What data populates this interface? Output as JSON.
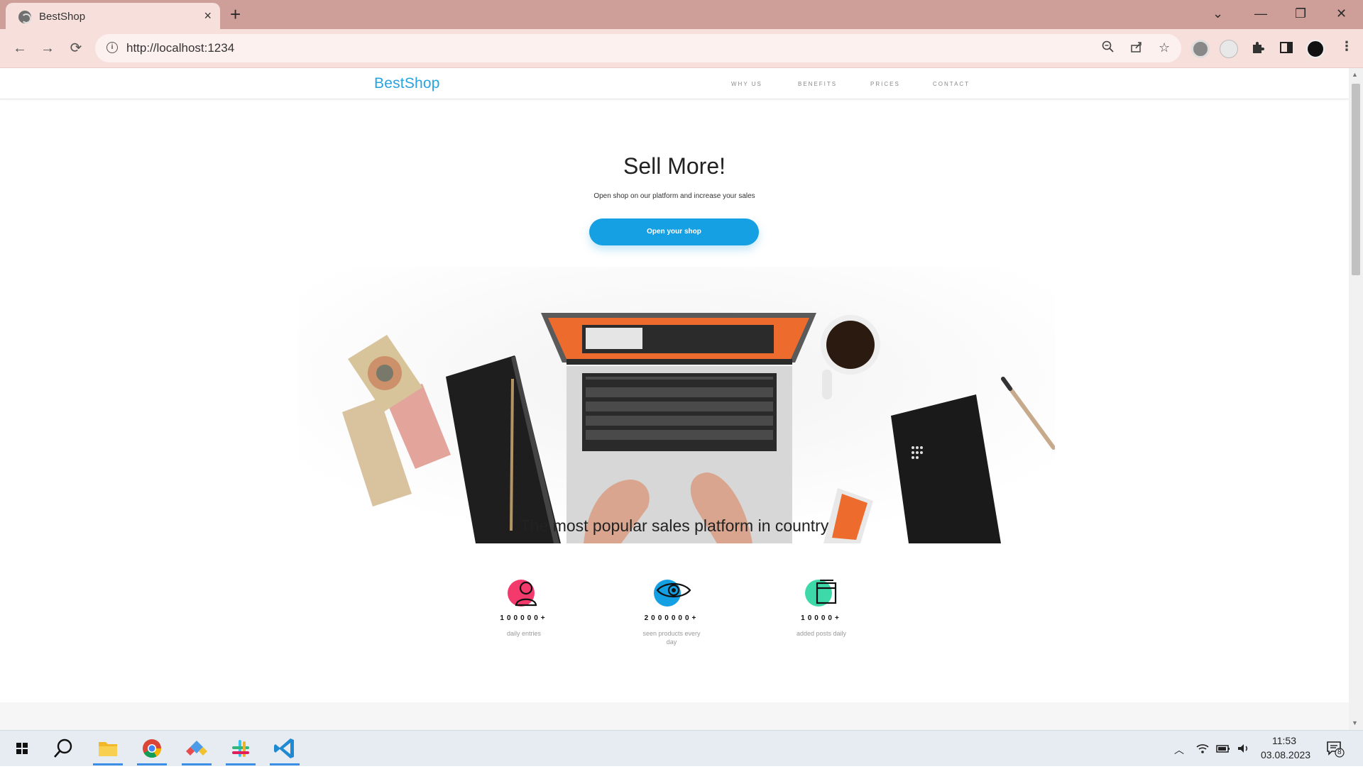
{
  "browser": {
    "tab_title": "BestShop",
    "tab_close": "×",
    "new_tab": "+",
    "url": "http://localhost:1234",
    "window_controls": {
      "dropdown": "⌄",
      "minimize": "—",
      "restore": "❐",
      "close": "✕"
    }
  },
  "site": {
    "logo": "BestShop",
    "nav": [
      "WHY US",
      "BENEFITS",
      "PRICES",
      "CONTACT"
    ]
  },
  "hero": {
    "title": "Sell More!",
    "subtitle": "Open shop on our platform and increase your sales",
    "cta_label": "Open your shop"
  },
  "stats": {
    "title": "The most popular sales platform in country",
    "items": [
      {
        "value": "100000+",
        "label": "daily entries",
        "icon": "user-icon",
        "color": "#f43a6d"
      },
      {
        "value": "2000000+",
        "label": "seen products every day",
        "icon": "eye-icon",
        "color": "#14a0e2"
      },
      {
        "value": "10000+",
        "label": "added posts daily",
        "icon": "window-icon",
        "color": "#3ed9a9"
      }
    ]
  },
  "taskbar": {
    "time": "11:53",
    "date": "03.08.2023",
    "notifications": "8"
  },
  "colors": {
    "titlebar": "#cd9f98",
    "toolbar": "#f7dfdb",
    "accent": "#14a0e2",
    "logo": "#29a3e0"
  }
}
